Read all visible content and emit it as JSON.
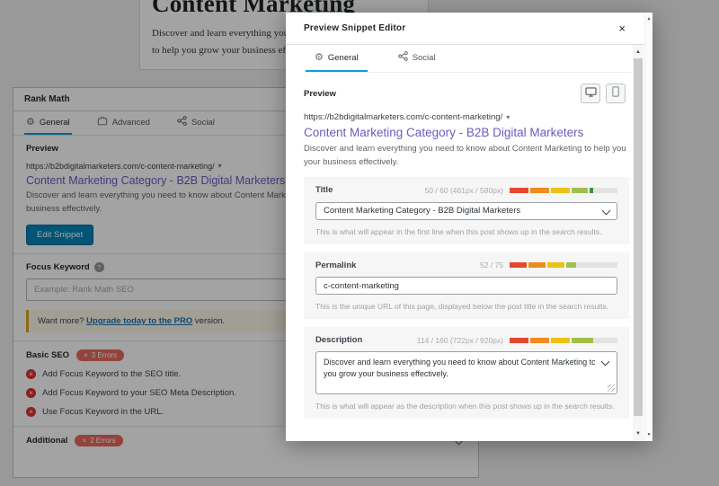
{
  "base": {
    "editor": {
      "heading": "Content Marketing",
      "paragraph_lines": [
        "Discover and learn everything you need to know about Content Marketing",
        "to help you grow your business effectively."
      ]
    }
  },
  "panel": {
    "title": "Rank Math",
    "tabs": [
      {
        "label": "General"
      },
      {
        "label": "Advanced"
      },
      {
        "label": "Social"
      }
    ],
    "preview": {
      "label": "Preview",
      "url": "https://b2bdigitalmarketers.com/c-content-marketing/",
      "title": "Content Marketing Category - B2B Digital Marketers",
      "description_lines": [
        "Discover and learn everything you need to know about Content Marketing to help you grow your",
        "business effectively."
      ],
      "edit_button": "Edit Snippet"
    },
    "focus_keyword": {
      "label": "Focus Keyword",
      "placeholder": "Example: Rank Math SEO",
      "notice_prefix": "Want more?",
      "notice_link": "Upgrade today to the PRO",
      "notice_suffix": "version."
    },
    "basic_seo": {
      "label": "Basic SEO",
      "badge": "3 Errors",
      "errors": [
        "Add Focus Keyword to the SEO title.",
        "Add Focus Keyword to your SEO Meta Description.",
        "Use Focus Keyword in the URL."
      ]
    },
    "additional": {
      "label": "Additional",
      "badge": "2 Errors"
    }
  },
  "modal": {
    "title": "Preview Snippet Editor",
    "tabs": [
      {
        "label": "General"
      },
      {
        "label": "Social"
      }
    ],
    "preview_label": "Preview",
    "serp": {
      "url": "https://b2bdigitalmarketers.com/c-content-marketing/",
      "title": "Content Marketing Category - B2B Digital Marketers",
      "description_lines": [
        "Discover and learn everything you need to know about Content Marketing to help you grow",
        "your business effectively."
      ]
    },
    "fields": {
      "title": {
        "label": "Title",
        "counter": "50 / 60 (461px / 580px)",
        "value": "Content Marketing Category - B2B Digital Marketers",
        "help": "This is what will appear in the first line when this post shows up in the search results.",
        "score_pct": 77
      },
      "permalink": {
        "label": "Permalink",
        "counter": "52 / 75",
        "value": "c-content-marketing",
        "help": "This is the unique URL of this page, displayed below the post title in the search results.",
        "score_pct": 61
      },
      "description": {
        "label": "Description",
        "counter": "114 / 160 (722px / 920px)",
        "value_lines": [
          "Discover and learn everything you need to know about Content Marketing to help",
          "you grow your business effectively."
        ],
        "help": "This is what will appear as the description when this post shows up in the search results.",
        "score_pct": 77
      }
    }
  },
  "icons": {
    "gear": "⚙",
    "caret_down": "▾",
    "close": "×",
    "info": "?",
    "badge_x": "×",
    "scroll_up": "▲",
    "scroll_down": "▼"
  },
  "colors": {
    "accent_blue": "#0aa0d6",
    "button_blue": "#0085ba",
    "link_purple": "#6a5bc2",
    "error_red": "#dc3232",
    "badge_red": "#e8695e",
    "notice_amber": "#dfa520",
    "bar_red": "#e3492f",
    "bar_orange": "#ef8b1f",
    "bar_yellow": "#ecc216",
    "bar_green": "#a0bf4c",
    "bar_dark_green": "#3d8f44"
  }
}
